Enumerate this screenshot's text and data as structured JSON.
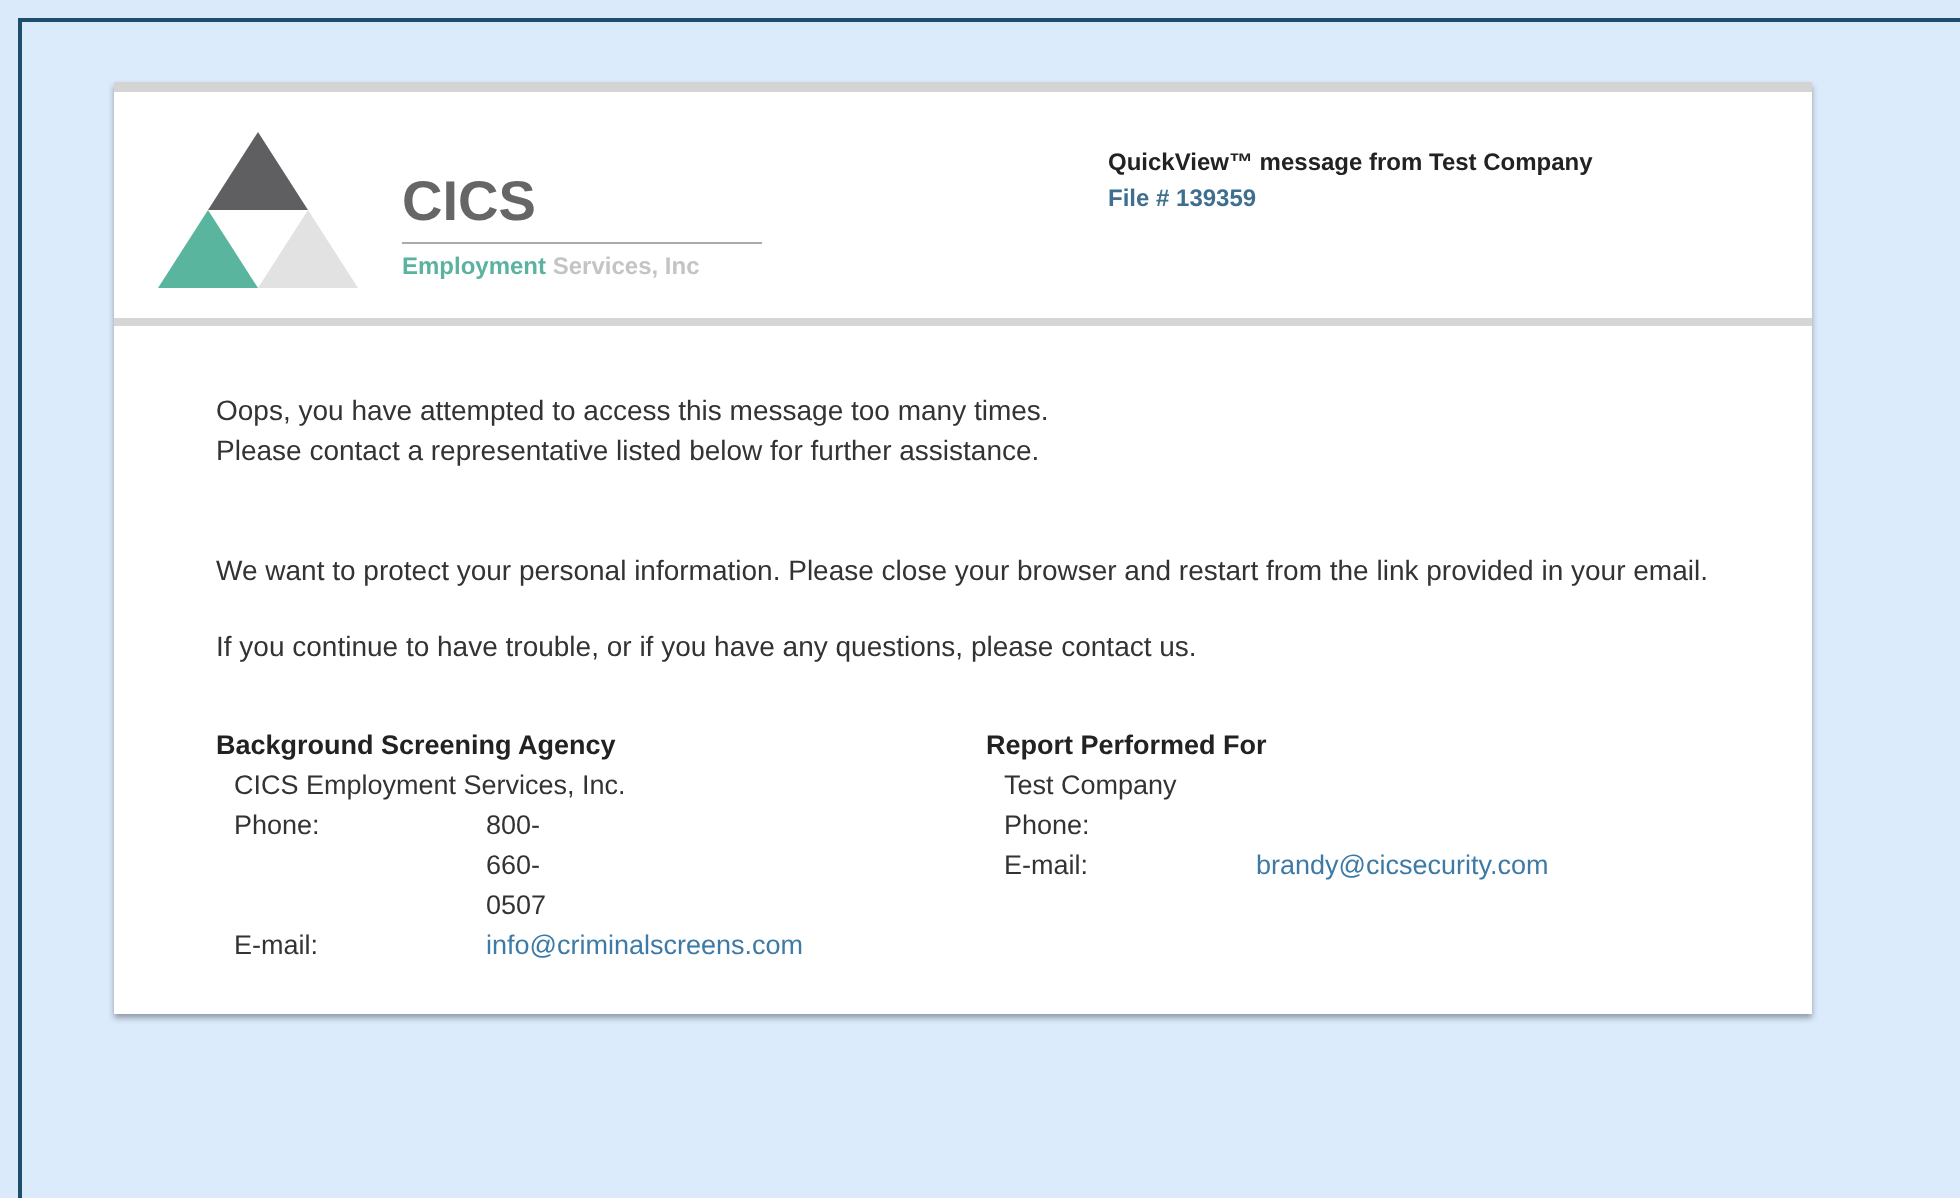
{
  "logo": {
    "name": "CICS",
    "tagline_accent": "Employment",
    "tagline_rest": "Services, Inc"
  },
  "header": {
    "title": "QuickView™ message from Test Company",
    "file": "File # 139359"
  },
  "messages": [
    {
      "lines": [
        "Oops, you have attempted to access this message too many times.",
        "Please contact a representative listed below for further assistance."
      ]
    },
    {
      "lines": [
        "We want to protect your personal information. Please close your browser and restart from the link provided in your email."
      ]
    },
    {
      "lines": [
        "If you continue to have trouble, or if you have any questions, please contact us."
      ]
    }
  ],
  "contacts": [
    {
      "heading": "Background Screening Agency",
      "name": "CICS Employment Services, Inc.",
      "fields": [
        {
          "label": "Phone:",
          "value": "800-660-0507",
          "kind": "text"
        },
        {
          "label": "E-mail:",
          "value": "info@criminalscreens.com",
          "kind": "link"
        }
      ]
    },
    {
      "heading": "Report Performed For",
      "name": "Test Company",
      "fields": [
        {
          "label": "Phone:"
        },
        {
          "label": "E-mail:",
          "value": "brandy@cicsecurity.com",
          "kind": "link"
        }
      ]
    }
  ]
}
